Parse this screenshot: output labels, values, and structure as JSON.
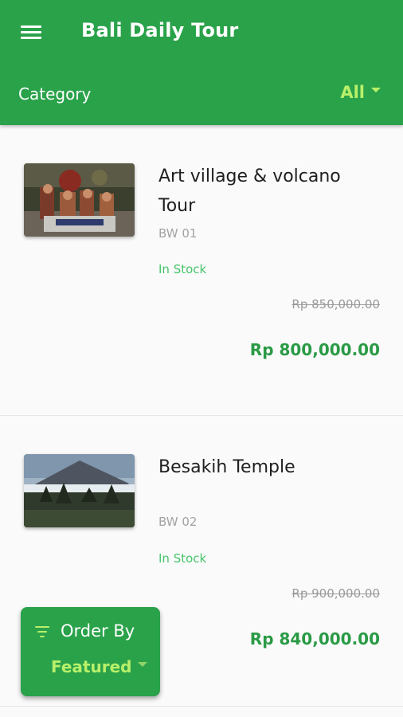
{
  "header": {
    "title": "Bali Daily Tour",
    "icon": "menu-icon",
    "category_label": "Category",
    "category_value": "All"
  },
  "products": [
    {
      "title_line1": "Art village & volcano",
      "title_line2": "Tour",
      "code": "BW 01",
      "stock": "In Stock",
      "old_price": "Rp 850,000.00",
      "price": "Rp 800,000.00"
    },
    {
      "title_line1": "Besakih Temple",
      "title_line2": "",
      "code": "BW 02",
      "stock": "In Stock",
      "old_price": "Rp 900,000.00",
      "price": "Rp 840,000.00"
    }
  ],
  "order_by": {
    "label": "Order By",
    "value": "Featured",
    "icon": "filter-icon"
  },
  "colors": {
    "primary": "#2aa24a",
    "accent": "#b8f06a",
    "price": "#2a9a45",
    "stock": "#46c56b"
  }
}
